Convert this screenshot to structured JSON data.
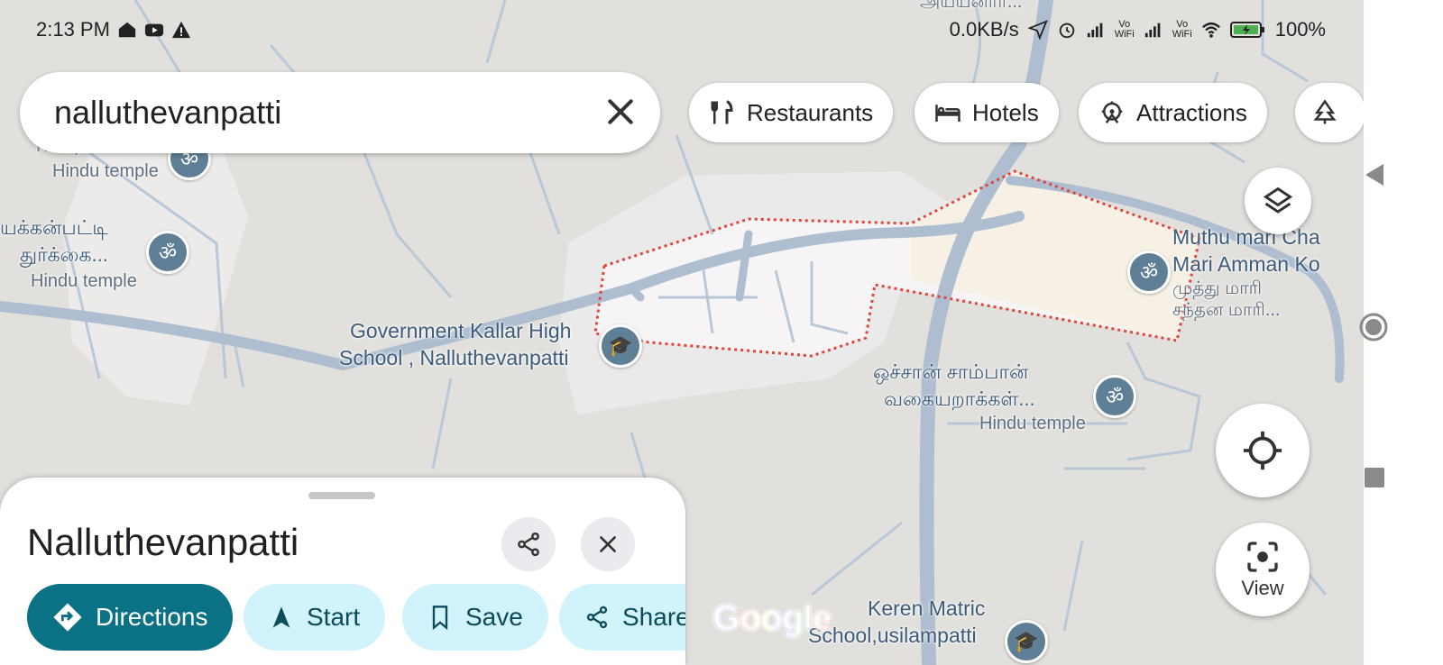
{
  "status_bar": {
    "time": "2:13 PM",
    "speed": "0.0KB/s",
    "battery": "100%",
    "vo_wifi_1_top": "Vo",
    "vo_wifi_1_bottom": "WiFi",
    "vo_wifi_2_top": "Vo",
    "vo_wifi_2_bottom": "WiFi"
  },
  "search": {
    "query": "nalluthevanpatti"
  },
  "chips": [
    {
      "label": "Restaurants",
      "icon": "fork-knife-icon"
    },
    {
      "label": "Hotels",
      "icon": "bed-icon"
    },
    {
      "label": "Attractions",
      "icon": "attraction-icon"
    }
  ],
  "map_labels": {
    "top_cut": "அயயனார்...",
    "temple_left_name": "Karupu Kovil",
    "temple_left_type": "Hindu temple",
    "durga_tamil_1": "யக்கன்பட்டி",
    "durga_tamil_2": "துர்க்கை...",
    "durga_type": "Hindu temple",
    "school_1": "Government Kallar High",
    "school_2": "School , Nalluthevanpatti",
    "muthu_1": "Muthu mari Cha",
    "muthu_2": "Mari Amman Ko",
    "muthu_3": "முத்து மாரி",
    "muthu_4": "சந்தன மாரி...",
    "ochan_1": "ஒச்சான் சாம்பான்",
    "ochan_2": "வகையறாக்கள்...",
    "ochan_type": "Hindu temple",
    "keren_1": "Keren Matric",
    "keren_2": "School,usilampatti",
    "google": "Google"
  },
  "fabs": {
    "view_label": "View"
  },
  "sheet": {
    "title": "Nalluthevanpatti",
    "actions": {
      "directions": "Directions",
      "start": "Start",
      "save": "Save",
      "share": "Share"
    }
  },
  "colors": {
    "map_bg": "#e2e0dc",
    "road": "#aebdd0",
    "boundary": "#e0443b",
    "primary": "#0b7285",
    "chip_light": "#d1f3fb"
  }
}
